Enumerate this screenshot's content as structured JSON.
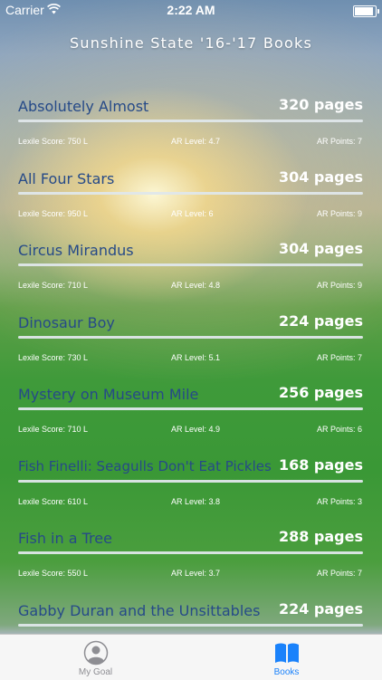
{
  "status_bar": {
    "carrier": "Carrier",
    "time": "2:22 AM"
  },
  "header": {
    "title": "Sunshine State '16-'17 Books"
  },
  "labels": {
    "lexile": "Lexile Score:",
    "ar_level": "AR Level:",
    "ar_points": "AR Points:"
  },
  "books": [
    {
      "title": "Absolutely Almost",
      "pages": "320 pages",
      "lexile": "Lexile Score: 750 L",
      "ar_level": "AR Level: 4.7",
      "ar_points": "AR Points: 7"
    },
    {
      "title": "All Four Stars",
      "pages": "304 pages",
      "lexile": "Lexile Score: 950 L",
      "ar_level": "AR Level: 6",
      "ar_points": "AR Points: 9"
    },
    {
      "title": "Circus Mirandus",
      "pages": "304 pages",
      "lexile": "Lexile Score: 710 L",
      "ar_level": "AR Level: 4.8",
      "ar_points": "AR Points: 9"
    },
    {
      "title": "Dinosaur Boy",
      "pages": "224 pages",
      "lexile": "Lexile Score: 730 L",
      "ar_level": "AR Level: 5.1",
      "ar_points": "AR Points: 7"
    },
    {
      "title": "Mystery on Museum Mile",
      "pages": "256 pages",
      "lexile": "Lexile Score: 710 L",
      "ar_level": "AR Level: 4.9",
      "ar_points": "AR Points: 6"
    },
    {
      "title": "Fish Finelli: Seagulls Don't Eat Pickles",
      "pages": "168 pages",
      "lexile": "Lexile Score: 610 L",
      "ar_level": "AR Level: 3.8",
      "ar_points": "AR Points: 3"
    },
    {
      "title": "Fish in a Tree",
      "pages": "288 pages",
      "lexile": "Lexile Score: 550 L",
      "ar_level": "AR Level: 3.7",
      "ar_points": "AR Points: 7"
    },
    {
      "title": "Gabby Duran and the Unsittables",
      "pages": "224 pages",
      "lexile": "",
      "ar_level": "",
      "ar_points": ""
    }
  ],
  "tabbar": {
    "tabs": [
      {
        "label": "My Goal",
        "icon": "person-icon",
        "selected": false
      },
      {
        "label": "Books",
        "icon": "book-icon",
        "selected": true
      }
    ],
    "active_color": "#1a82fb",
    "inactive_color": "#8e8e93"
  }
}
